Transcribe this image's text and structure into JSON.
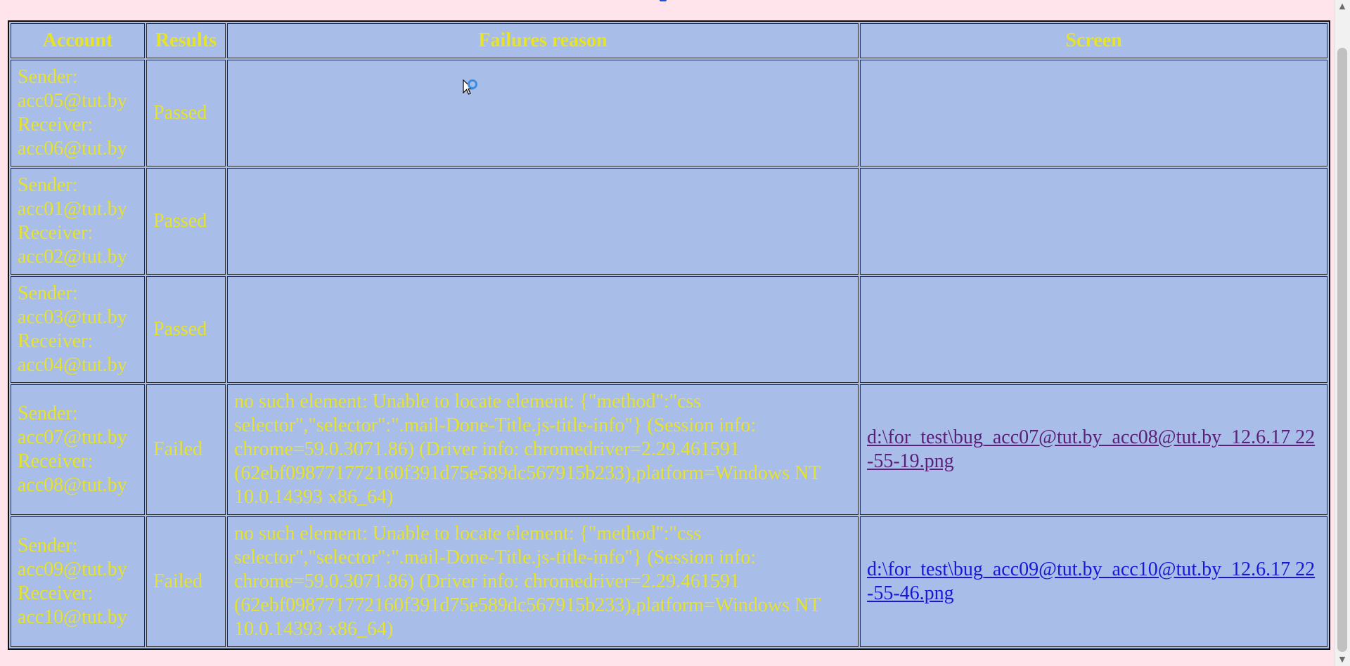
{
  "table": {
    "headers": {
      "account": "Account",
      "results": "Results",
      "failures": "Failures reason",
      "screen": "Screen"
    },
    "rows": [
      {
        "sender_label": "Sender:",
        "sender": "acc05@tut.by",
        "receiver_label": "Receiver:",
        "receiver": "acc06@tut.by",
        "result": "Passed",
        "reason": "",
        "screen": ""
      },
      {
        "sender_label": "Sender:",
        "sender": "acc01@tut.by",
        "receiver_label": "Receiver:",
        "receiver": "acc02@tut.by",
        "result": "Passed",
        "reason": "",
        "screen": ""
      },
      {
        "sender_label": "Sender:",
        "sender": "acc03@tut.by",
        "receiver_label": "Receiver:",
        "receiver": "acc04@tut.by",
        "result": "Passed",
        "reason": "",
        "screen": ""
      },
      {
        "sender_label": "Sender:",
        "sender": "acc07@tut.by",
        "receiver_label": "Receiver:",
        "receiver": "acc08@tut.by",
        "result": "Failed",
        "reason": "no such element: Unable to locate element: {\"method\":\"css selector\",\"selector\":\".mail-Done-Title.js-title-info\"} (Session info: chrome=59.0.3071.86) (Driver info: chromedriver=2.29.461591 (62ebf098771772160f391d75e589dc567915b233),platform=Windows NT 10.0.14393 x86_64)",
        "screen": "d:\\for_test\\bug_acc07@tut.by_acc08@tut.by_12.6.17 22-55-19.png"
      },
      {
        "sender_label": "Sender:",
        "sender": "acc09@tut.by",
        "receiver_label": "Receiver:",
        "receiver": "acc10@tut.by",
        "result": "Failed",
        "reason": "no such element: Unable to locate element: {\"method\":\"css selector\",\"selector\":\".mail-Done-Title.js-title-info\"} (Session info: chrome=59.0.3071.86) (Driver info: chromedriver=2.29.461591 (62ebf098771772160f391d75e589dc567915b233),platform=Windows NT 10.0.14393 x86_64)",
        "screen": "d:\\for_test\\bug_acc09@tut.by_acc10@tut.by_12.6.17 22-55-46.png"
      }
    ]
  },
  "colors": {
    "page_bg": "#ffe4ec",
    "cell_bg": "#a9bde9",
    "text": "#e6e32a",
    "link": "#1a16d6",
    "link_visited": "#5a1f78"
  },
  "icons": {
    "cursor": "busy-pointer-icon",
    "scroll_up": "scroll-up-arrow-icon",
    "scroll_down": "scroll-down-arrow-icon"
  }
}
